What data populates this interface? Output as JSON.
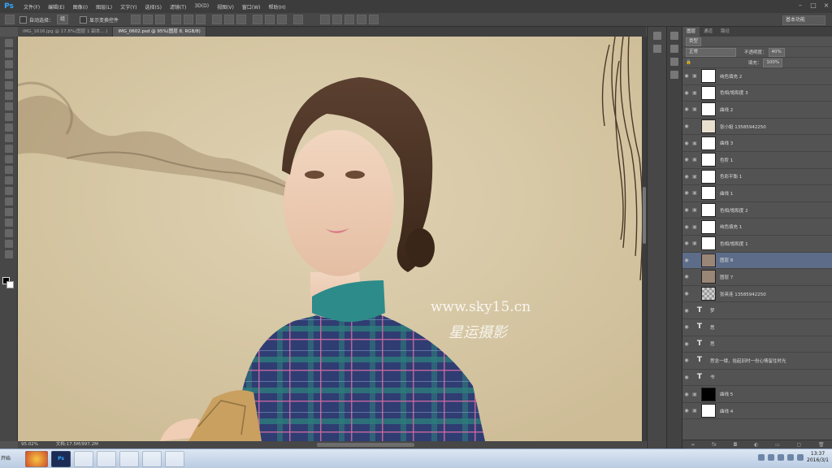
{
  "app": {
    "logo": "Ps"
  },
  "menu": [
    "文件(F)",
    "编辑(E)",
    "图像(I)",
    "图层(L)",
    "文字(Y)",
    "选择(S)",
    "滤镜(T)",
    "3D(D)",
    "视图(V)",
    "窗口(W)",
    "帮助(H)"
  ],
  "options": {
    "auto_select_label": "自动选择：",
    "auto_select_value": "组",
    "show_transform_label": "显示变换控件",
    "workspace": "基本功能"
  },
  "tabs": [
    "IMG_1616.jpg @ 17.8%(图层 1 副本,...)",
    "IMG_0602.psd @ 95%(图层 8, RGB/8)"
  ],
  "status": {
    "zoom": "95.02%",
    "doc": "文档:17.5M/997.2M"
  },
  "layers_panel": {
    "tabs": [
      "图层",
      "通道",
      "路径"
    ],
    "filter": "类型",
    "blend": "正常",
    "opacity_label": "不透明度：",
    "opacity": "40%",
    "fill_label": "填充：",
    "fill": "100%",
    "layers": [
      {
        "name": "纯色填充 2",
        "type": "adjust",
        "thumb": "white"
      },
      {
        "name": "色相/饱和度 3",
        "type": "adjust",
        "thumb": "white"
      },
      {
        "name": "曲线 2",
        "type": "adjust",
        "thumb": "white"
      },
      {
        "name": "张小姐 13585942250",
        "type": "image",
        "thumb": "img"
      },
      {
        "name": "曲线 3",
        "type": "adjust",
        "thumb": "white"
      },
      {
        "name": "色阶 1",
        "type": "adjust",
        "thumb": "white"
      },
      {
        "name": "色彩平衡 1",
        "type": "adjust",
        "thumb": "white"
      },
      {
        "name": "曲线 1",
        "type": "adjust",
        "thumb": "white"
      },
      {
        "name": "色相/饱和度 2",
        "type": "adjust",
        "thumb": "white"
      },
      {
        "name": "纯色填充 1",
        "type": "adjust",
        "thumb": "white"
      },
      {
        "name": "色相/饱和度 1",
        "type": "adjust",
        "thumb": "white"
      },
      {
        "name": "图层 8",
        "type": "image",
        "thumb": "photo",
        "selected": true
      },
      {
        "name": "图层 7",
        "type": "image",
        "thumb": "photo"
      },
      {
        "name": "张英连 13585942250",
        "type": "image",
        "thumb": "trans"
      },
      {
        "name": "梦",
        "type": "text"
      },
      {
        "name": "思",
        "type": "text"
      },
      {
        "name": "思",
        "type": "text"
      },
      {
        "name": "思念一缕，拾起旧时一份心情留住时光",
        "type": "text"
      },
      {
        "name": "书",
        "type": "text"
      },
      {
        "name": "曲线 5",
        "type": "adjust",
        "thumb": "black"
      },
      {
        "name": "曲线 4",
        "type": "adjust",
        "thumb": "white"
      }
    ]
  },
  "watermark": {
    "url": "www.sky15.cn",
    "studio": "星运摄影"
  },
  "taskbar": {
    "start": "开始",
    "apps": [
      "Ps",
      "",
      "",
      "",
      ""
    ],
    "time": "13:37",
    "date": "2016/3/1"
  },
  "colors": {
    "accent": "#31a8ff",
    "selected_layer": "#5d6c89",
    "canvas": "#d7c8a6"
  }
}
